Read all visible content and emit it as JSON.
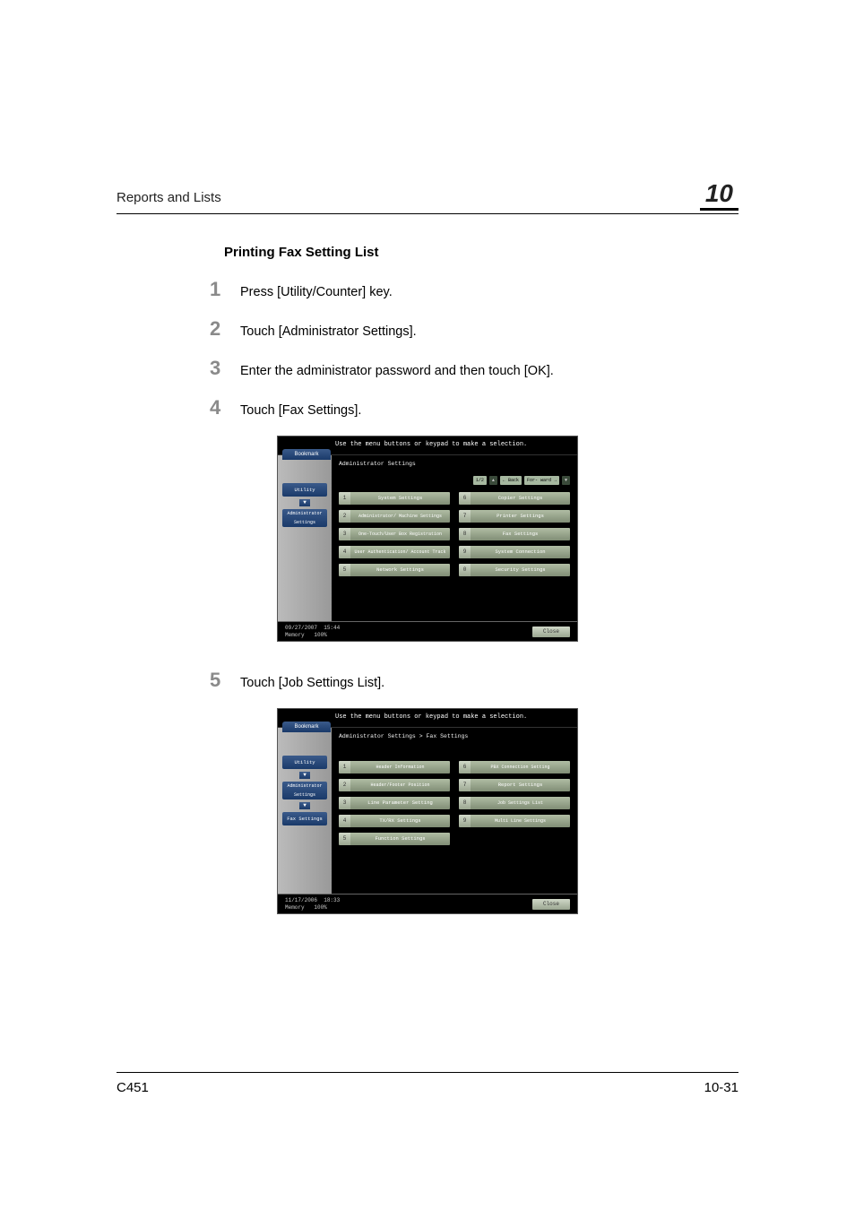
{
  "header": {
    "left": "Reports and Lists",
    "chapter": "10"
  },
  "section_title": "Printing Fax Setting List",
  "steps": [
    {
      "num": "1",
      "text": "Press [Utility/Counter] key."
    },
    {
      "num": "2",
      "text": "Touch [Administrator Settings]."
    },
    {
      "num": "3",
      "text": "Enter the administrator password and then touch [OK]."
    },
    {
      "num": "4",
      "text": "Touch [Fax Settings]."
    },
    {
      "num": "5",
      "text": "Touch [Job Settings List]."
    }
  ],
  "screenshot1": {
    "instruction": "Use the menu buttons or keypad to make a selection.",
    "bookmark": "Bookmark",
    "sidebar": {
      "utility": "Utility",
      "admin": "Administrator Settings"
    },
    "breadcrumb": "Administrator Settings",
    "page_indicator": "1/2",
    "back": "Back",
    "forward": "For-\nward",
    "menu_left": [
      {
        "n": "1",
        "label": "System Settings"
      },
      {
        "n": "2",
        "label": "Administrator/\nMachine Settings"
      },
      {
        "n": "3",
        "label": "One-Touch/User Box\nRegistration"
      },
      {
        "n": "4",
        "label": "User Authentication/\nAccount Track"
      },
      {
        "n": "5",
        "label": "Network Settings"
      }
    ],
    "menu_right": [
      {
        "n": "6",
        "label": "Copier Settings"
      },
      {
        "n": "7",
        "label": "Printer Settings"
      },
      {
        "n": "8",
        "label": "Fax Settings"
      },
      {
        "n": "9",
        "label": "System Connection"
      },
      {
        "n": "0",
        "label": "Security Settings"
      }
    ],
    "footer_date": "09/27/2007",
    "footer_time": "15:44",
    "footer_mem_label": "Memory",
    "footer_mem_val": "100%",
    "close": "Close"
  },
  "screenshot2": {
    "instruction": "Use the menu buttons or keypad to make a selection.",
    "bookmark": "Bookmark",
    "sidebar": {
      "utility": "Utility",
      "admin": "Administrator Settings",
      "fax": "Fax Settings"
    },
    "breadcrumb": "Administrator Settings  > Fax Settings",
    "menu_left": [
      {
        "n": "1",
        "label": "Header\nInformation"
      },
      {
        "n": "2",
        "label": "Header/Footer\nPosition"
      },
      {
        "n": "3",
        "label": "Line Parameter Setting"
      },
      {
        "n": "4",
        "label": "TX/RX Settings"
      },
      {
        "n": "5",
        "label": "Function Settings"
      }
    ],
    "menu_right": [
      {
        "n": "6",
        "label": "PBX Connection\nSetting"
      },
      {
        "n": "7",
        "label": "Report Settings"
      },
      {
        "n": "8",
        "label": "Job Settings\nList"
      },
      {
        "n": "9",
        "label": "Multi Line\nSettings"
      }
    ],
    "footer_date": "11/17/2006",
    "footer_time": "18:33",
    "footer_mem_label": "Memory",
    "footer_mem_val": "100%",
    "close": "Close"
  },
  "footer": {
    "left": "C451",
    "right": "10-31"
  }
}
